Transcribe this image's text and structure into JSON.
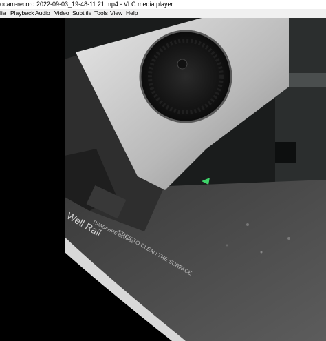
{
  "window": {
    "title": "ocam-record.2022-09-03_19-48-11.21.mp4 - VLC media player"
  },
  "menubar": {
    "items": [
      "lia",
      "Playback",
      "Audio",
      "Video",
      "Subtitle",
      "Tools",
      "View",
      "Help"
    ]
  },
  "video": {
    "bed_text_1": "Well Rail",
    "bed_text_2": "ПЛАВАНИЕ ВОЛНА",
    "bed_text_3": "STICK TO CLEAN THE SURFACE"
  },
  "colors": {
    "titlebar_bg": "#ffffff",
    "menubar_bg": "#f0f0f0",
    "video_bg": "#000000",
    "accent_green": "#3fd36a"
  }
}
